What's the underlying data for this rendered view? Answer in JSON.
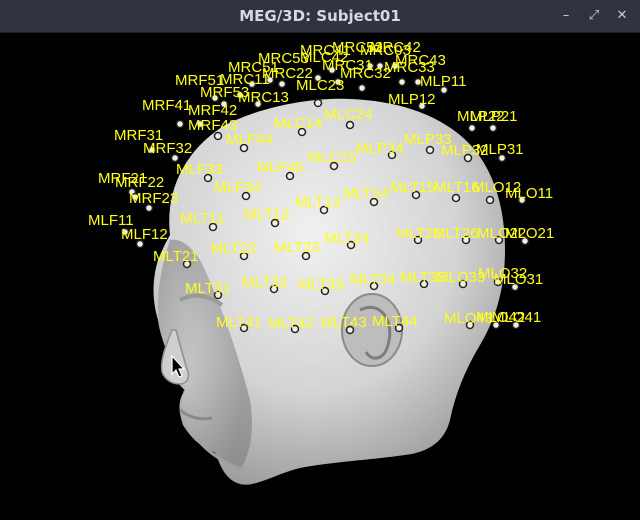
{
  "window": {
    "title": "MEG/3D: Subject01",
    "buttons": {
      "minimize": "–",
      "maximize": "⤢",
      "close": "✕"
    }
  },
  "view": {
    "background": "#000000",
    "label_color": "#ffff1a",
    "head_color": "#d8d8d8"
  },
  "sensors": [
    {
      "label": "MRC41"
    },
    {
      "label": "MRC52"
    },
    {
      "label": "MRC42"
    },
    {
      "label": "MLC42"
    },
    {
      "label": "MRC03"
    },
    {
      "label": "MRC43"
    },
    {
      "label": "MRC31"
    },
    {
      "label": "MRC32"
    },
    {
      "label": "MRC33"
    },
    {
      "label": "MRC53"
    },
    {
      "label": "MRC51"
    },
    {
      "label": "MRC11"
    },
    {
      "label": "MRC22"
    },
    {
      "label": "MLC23"
    },
    {
      "label": "MRF51"
    },
    {
      "label": "MRF53"
    },
    {
      "label": "MRC13"
    },
    {
      "label": "MLP11"
    },
    {
      "label": "MLP12"
    },
    {
      "label": "MRF41"
    },
    {
      "label": "MRF42"
    },
    {
      "label": "MRF43"
    },
    {
      "label": "MLC14"
    },
    {
      "label": "MLC24"
    },
    {
      "label": "MLP22"
    },
    {
      "label": "MLP21"
    },
    {
      "label": "MRF31"
    },
    {
      "label": "MRF32"
    },
    {
      "label": "MLF44"
    },
    {
      "label": "MLP33"
    },
    {
      "label": "MLP34"
    },
    {
      "label": "MLP32"
    },
    {
      "label": "MLP31"
    },
    {
      "label": "MLC15"
    },
    {
      "label": "MLF33"
    },
    {
      "label": "MLF45"
    },
    {
      "label": "MRF21"
    },
    {
      "label": "MRF22"
    },
    {
      "label": "MLF34"
    },
    {
      "label": "MLT15"
    },
    {
      "label": "MLT16"
    },
    {
      "label": "MLO12"
    },
    {
      "label": "MLO11"
    },
    {
      "label": "MRF23"
    },
    {
      "label": "MLT13"
    },
    {
      "label": "MLT14"
    },
    {
      "label": "MLT11"
    },
    {
      "label": "MLT12"
    },
    {
      "label": "MLF11"
    },
    {
      "label": "MLF12"
    },
    {
      "label": "MLT25"
    },
    {
      "label": "MLT26"
    },
    {
      "label": "MLO22"
    },
    {
      "label": "MLO21"
    },
    {
      "label": "MLT24"
    },
    {
      "label": "MLT21"
    },
    {
      "label": "MLT22"
    },
    {
      "label": "MLT23"
    },
    {
      "label": "MLO32"
    },
    {
      "label": "MLO31"
    },
    {
      "label": "MLT35"
    },
    {
      "label": "MLO33"
    },
    {
      "label": "MLT34"
    },
    {
      "label": "MLT31"
    },
    {
      "label": "MLT32"
    },
    {
      "label": "MLT33"
    },
    {
      "label": "MLO42"
    },
    {
      "label": "MLO41"
    },
    {
      "label": "MLO43"
    },
    {
      "label": "MLT44"
    },
    {
      "label": "MLT41"
    },
    {
      "label": "MLT42"
    },
    {
      "label": "MLT43"
    }
  ]
}
